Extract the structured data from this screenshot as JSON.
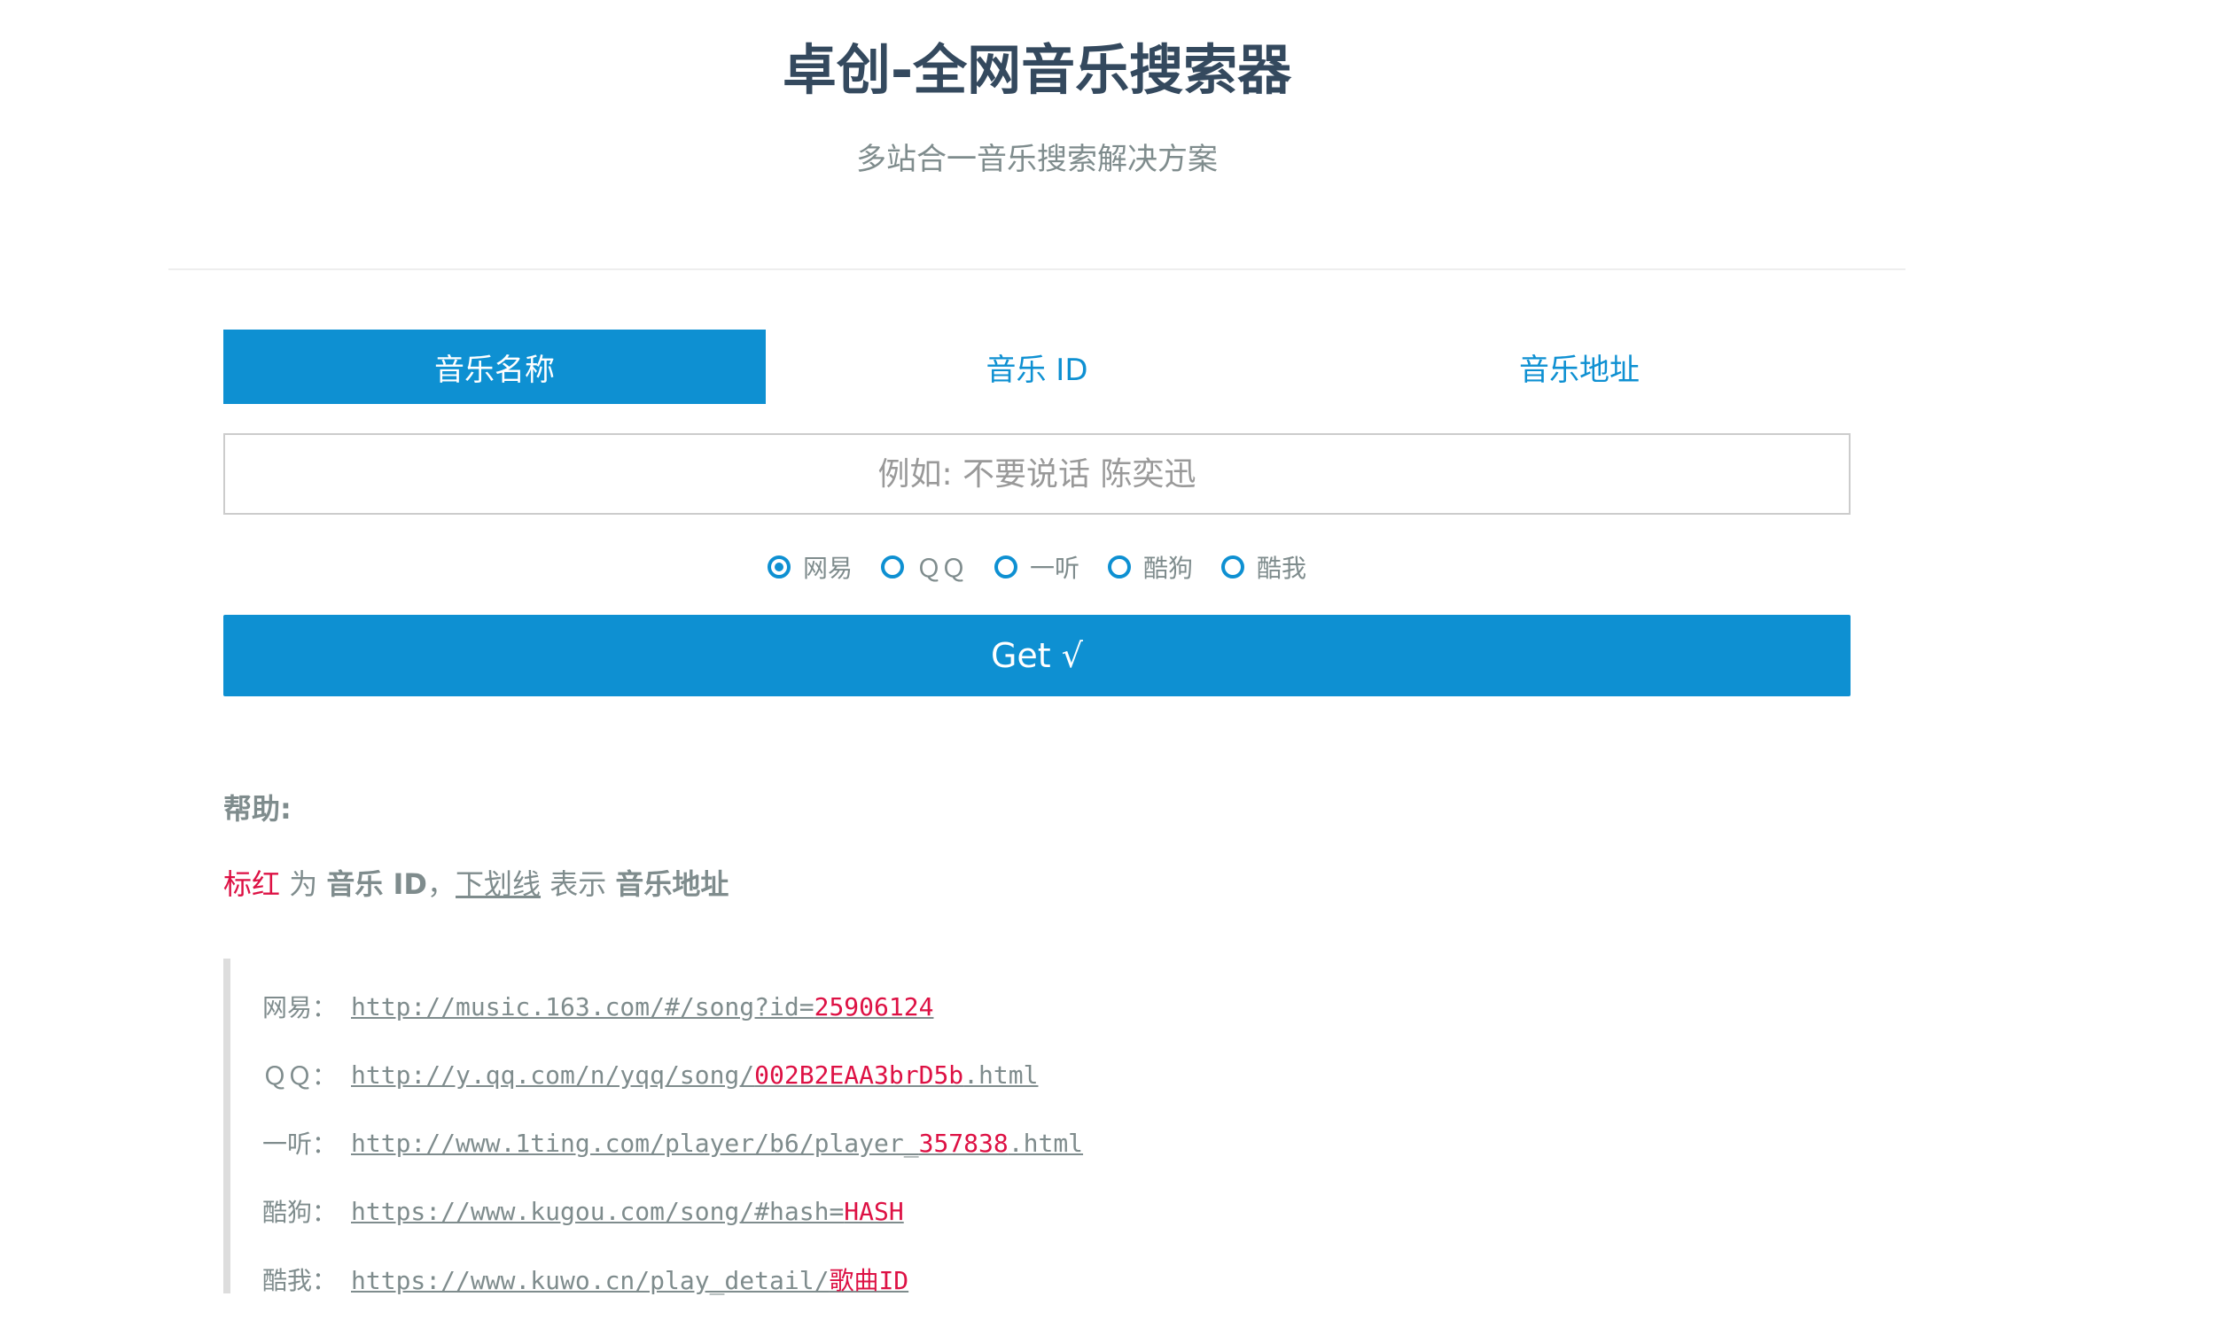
{
  "header": {
    "title": "卓创-全网音乐搜索器",
    "subtitle": "多站合一音乐搜索解决方案"
  },
  "tabs": [
    {
      "label": "音乐名称",
      "active": true
    },
    {
      "label": "音乐 ID",
      "active": false
    },
    {
      "label": "音乐地址",
      "active": false
    }
  ],
  "search": {
    "placeholder": "例如: 不要说话 陈奕迅",
    "value": ""
  },
  "sources": [
    {
      "label": "网易",
      "checked": true
    },
    {
      "label": "ＱＱ",
      "checked": false
    },
    {
      "label": "一听",
      "checked": false
    },
    {
      "label": "酷狗",
      "checked": false
    },
    {
      "label": "酷我",
      "checked": false
    }
  ],
  "get_button": {
    "label": "Get √"
  },
  "help": {
    "title": "帮助:",
    "legend": {
      "red_word": "标红",
      "is_text": " 为 ",
      "id_term": "音乐 ID",
      "comma": "，",
      "underline_word": "下划线",
      "means_text": " 表示 ",
      "url_term": "音乐地址"
    },
    "examples": [
      {
        "label": "网易：",
        "prefix": "http://music.163.com/#/song?id=",
        "highlight": "25906124",
        "suffix": ""
      },
      {
        "label": "ＱＱ：",
        "prefix": "http://y.qq.com/n/yqq/song/",
        "highlight": "002B2EAA3brD5b",
        "suffix": ".html"
      },
      {
        "label": "一听：",
        "prefix": "http://www.1ting.com/player/b6/player_",
        "highlight": "357838",
        "suffix": ".html"
      },
      {
        "label": "酷狗：",
        "prefix": "https://www.kugou.com/song/#hash=",
        "highlight": "HASH",
        "suffix": ""
      },
      {
        "label": "酷我：",
        "prefix": "https://www.kuwo.cn/play_detail/",
        "highlight": "歌曲ID",
        "suffix": ""
      }
    ]
  },
  "colors": {
    "accent": "#0e90d2",
    "highlight": "#dd1144",
    "title": "#34495e",
    "text": "#7f8c8d"
  }
}
